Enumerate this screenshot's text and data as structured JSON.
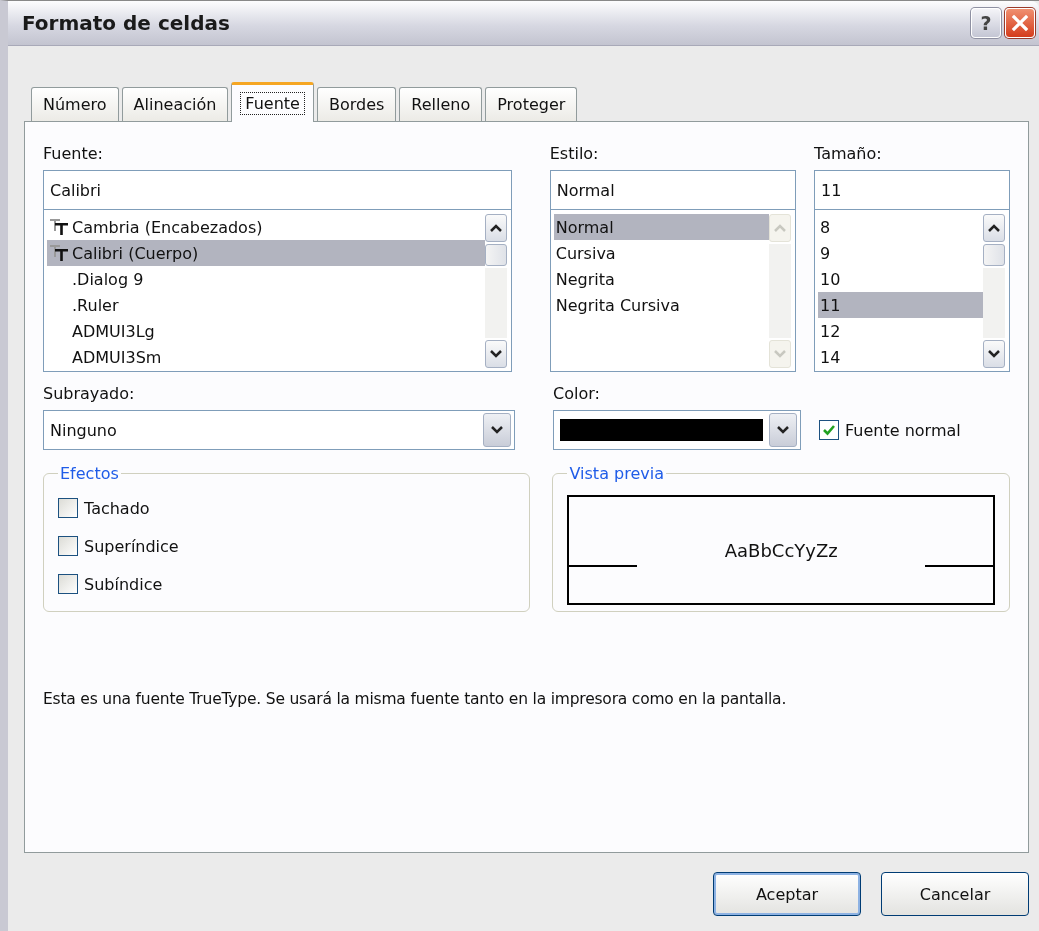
{
  "window": {
    "title": "Formato de celdas",
    "help_button": "?"
  },
  "tabs": [
    {
      "label": "Número",
      "selected": false
    },
    {
      "label": "Alineación",
      "selected": false
    },
    {
      "label": "Fuente",
      "selected": true
    },
    {
      "label": "Bordes",
      "selected": false
    },
    {
      "label": "Relleno",
      "selected": false
    },
    {
      "label": "Proteger",
      "selected": false
    }
  ],
  "font": {
    "label": "Fuente:",
    "value": "Calibri",
    "items": [
      {
        "name": "Cambria (Encabezados)",
        "kind": "truetype",
        "selected": false
      },
      {
        "name": "Calibri (Cuerpo)",
        "kind": "truetype",
        "selected": true
      },
      {
        "name": ".Dialog 9",
        "kind": "plain",
        "selected": false
      },
      {
        "name": ".Ruler",
        "kind": "plain",
        "selected": false
      },
      {
        "name": "ADMUI3Lg",
        "kind": "plain",
        "selected": false
      },
      {
        "name": "ADMUI3Sm",
        "kind": "plain",
        "selected": false
      }
    ],
    "scroll_enabled": true
  },
  "style": {
    "label": "Estilo:",
    "value": "Normal",
    "items": [
      {
        "name": "Normal",
        "selected": true
      },
      {
        "name": "Cursiva",
        "selected": false
      },
      {
        "name": "Negrita",
        "selected": false
      },
      {
        "name": "Negrita Cursiva",
        "selected": false
      }
    ],
    "scroll_enabled": false
  },
  "size": {
    "label": "Tamaño:",
    "value": "11",
    "items": [
      {
        "name": "8",
        "selected": false
      },
      {
        "name": "9",
        "selected": false
      },
      {
        "name": "10",
        "selected": false
      },
      {
        "name": "11",
        "selected": true
      },
      {
        "name": "12",
        "selected": false
      },
      {
        "name": "14",
        "selected": false
      }
    ],
    "scroll_enabled": true
  },
  "underline": {
    "label": "Subrayado:",
    "value": "Ninguno"
  },
  "color": {
    "label": "Color:",
    "color": "#000000"
  },
  "normal_font": {
    "label": "Fuente normal",
    "checked": true
  },
  "effects": {
    "title": "Efectos",
    "items": [
      {
        "label": "Tachado",
        "checked": false
      },
      {
        "label": "Superíndice",
        "checked": false
      },
      {
        "label": "Subíndice",
        "checked": false
      }
    ]
  },
  "preview": {
    "title": "Vista previa",
    "sample": "AaBbCcYyZz"
  },
  "info": "Esta es una fuente TrueType. Se usará la misma fuente tanto en la impresora como en la pantalla.",
  "buttons": [
    "Aceptar",
    "Cancelar"
  ]
}
